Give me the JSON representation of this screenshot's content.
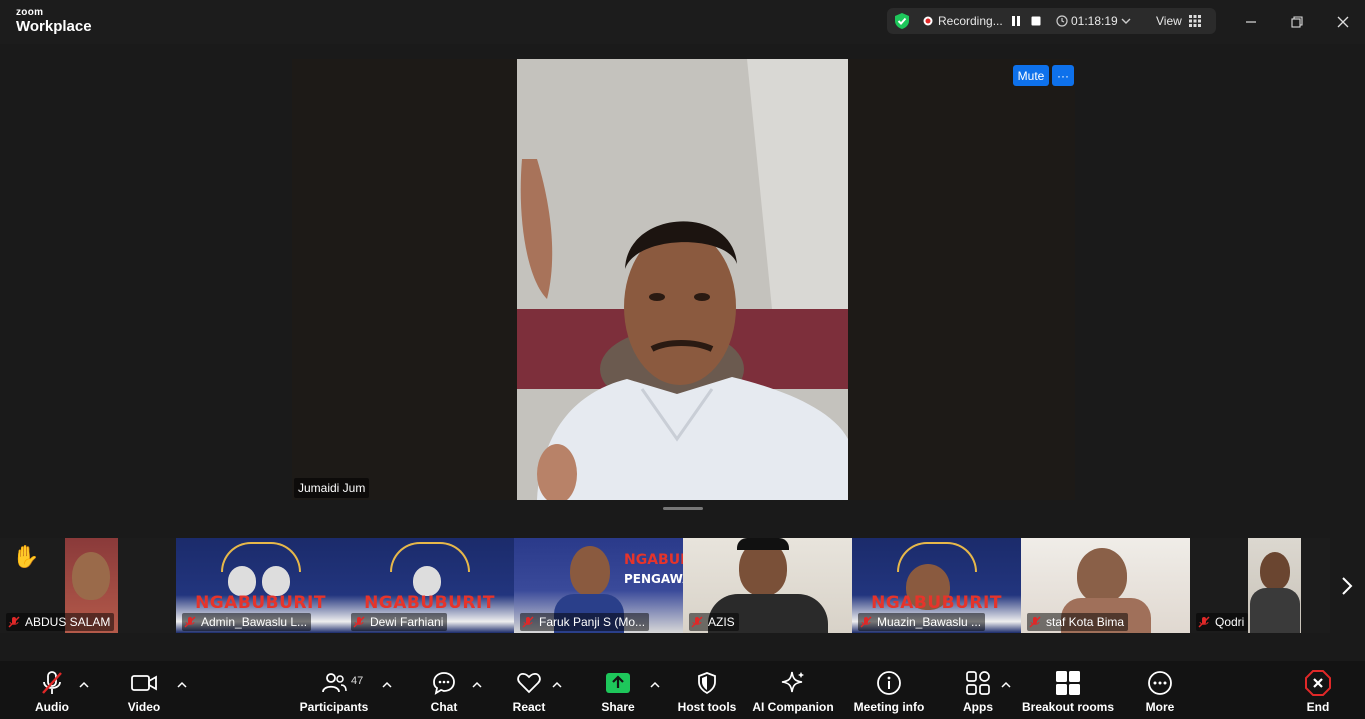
{
  "app": {
    "brand_small": "zoom",
    "brand_large": "Workplace"
  },
  "recording": {
    "label": "Recording...",
    "timer": "01:18:19",
    "view_label": "View"
  },
  "speaker": {
    "name": "Jumaidi Jum",
    "mute_label": "Mute",
    "more_label": "···"
  },
  "participants_strip": [
    {
      "name": "ABDUS SALAM"
    },
    {
      "name": "Admin_Bawaslu L..."
    },
    {
      "name": "Dewi Farhiani"
    },
    {
      "name": "Faruk Panji S (Mo..."
    },
    {
      "name": "AZIS"
    },
    {
      "name": "Muazin_Bawaslu ..."
    },
    {
      "name": "staf Kota Bima"
    },
    {
      "name": "Qodri"
    }
  ],
  "banner_text": "NGABUBURIT",
  "banner_text_partial": "NGABUBU",
  "banner_sub": "PENGAWAS",
  "toolbar": {
    "audio": "Audio",
    "video": "Video",
    "participants": "Participants",
    "participants_count": "47",
    "chat": "Chat",
    "react": "React",
    "share": "Share",
    "host_tools": "Host tools",
    "ai_companion": "AI Companion",
    "meeting_info": "Meeting info",
    "apps": "Apps",
    "breakout_rooms": "Breakout rooms",
    "more": "More",
    "end": "End"
  },
  "colors": {
    "accent_blue": "#0e71eb",
    "share_green": "#1ec75b",
    "end_red": "#e02828",
    "banner_blue": "#1b2b6b"
  }
}
